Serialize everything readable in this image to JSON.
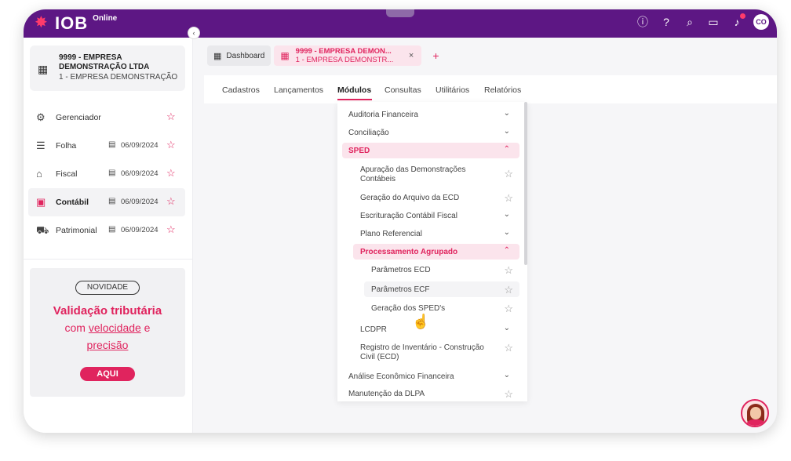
{
  "app": {
    "logo": "IOB",
    "logo_sub": "Online"
  },
  "topbar": {
    "icons": [
      "info-icon",
      "help-icon",
      "search-icon",
      "folder-icon",
      "bell-icon"
    ],
    "user_initials": "CO"
  },
  "company": {
    "name": "9999 - EMPRESA DEMONSTRAÇÃO LTDA",
    "sub": "1 - EMPRESA DEMONSTRAÇÃO"
  },
  "sidebar": {
    "items": [
      {
        "label": "Gerenciador",
        "date": ""
      },
      {
        "label": "Folha",
        "date": "06/09/2024"
      },
      {
        "label": "Fiscal",
        "date": "06/09/2024"
      },
      {
        "label": "Contábil",
        "date": "06/09/2024"
      },
      {
        "label": "Patrimonial",
        "date": "06/09/2024"
      }
    ]
  },
  "promo": {
    "tag": "NOVIDADE",
    "title": "Validação tributária",
    "line1_pre": "com ",
    "line1_link": "velocidade",
    "line1_post": " e",
    "line2": "precisão",
    "button": "AQUI"
  },
  "tabs": {
    "dashboard": "Dashboard",
    "company_line1": "9999 - EMPRESA DEMON...",
    "company_line2": "1 - EMPRESA DEMONSTR...",
    "close": "×",
    "add": "+"
  },
  "menu": [
    "Cadastros",
    "Lançamentos",
    "Módulos",
    "Consultas",
    "Utilitários",
    "Relatórios"
  ],
  "dropdown": {
    "auditoria": "Auditoria Financeira",
    "conciliacao": "Conciliação",
    "sped": "SPED",
    "apuracao_1": "Apuração das Demonstrações",
    "apuracao_2": "Contábeis",
    "geracao_ecd": "Geração do Arquivo da ECD",
    "ecf": "Escrituração Contábil Fiscal",
    "plano": "Plano Referencial",
    "processamento": "Processamento Agrupado",
    "param_ecd": "Parâmetros ECD",
    "param_ecf": "Parâmetros ECF",
    "geracao_sped": "Geração dos SPED's",
    "lcdpr": "LCDPR",
    "registro_1": "Registro de Inventário - Construção",
    "registro_2": "Civil (ECD)",
    "analise": "Análise Econômico Financeira",
    "dlpa": "Manutenção da DLPA"
  },
  "colors": {
    "brand_purple": "#5d1784",
    "accent_pink": "#e0245e",
    "pink_bg": "#fbe4ec"
  }
}
